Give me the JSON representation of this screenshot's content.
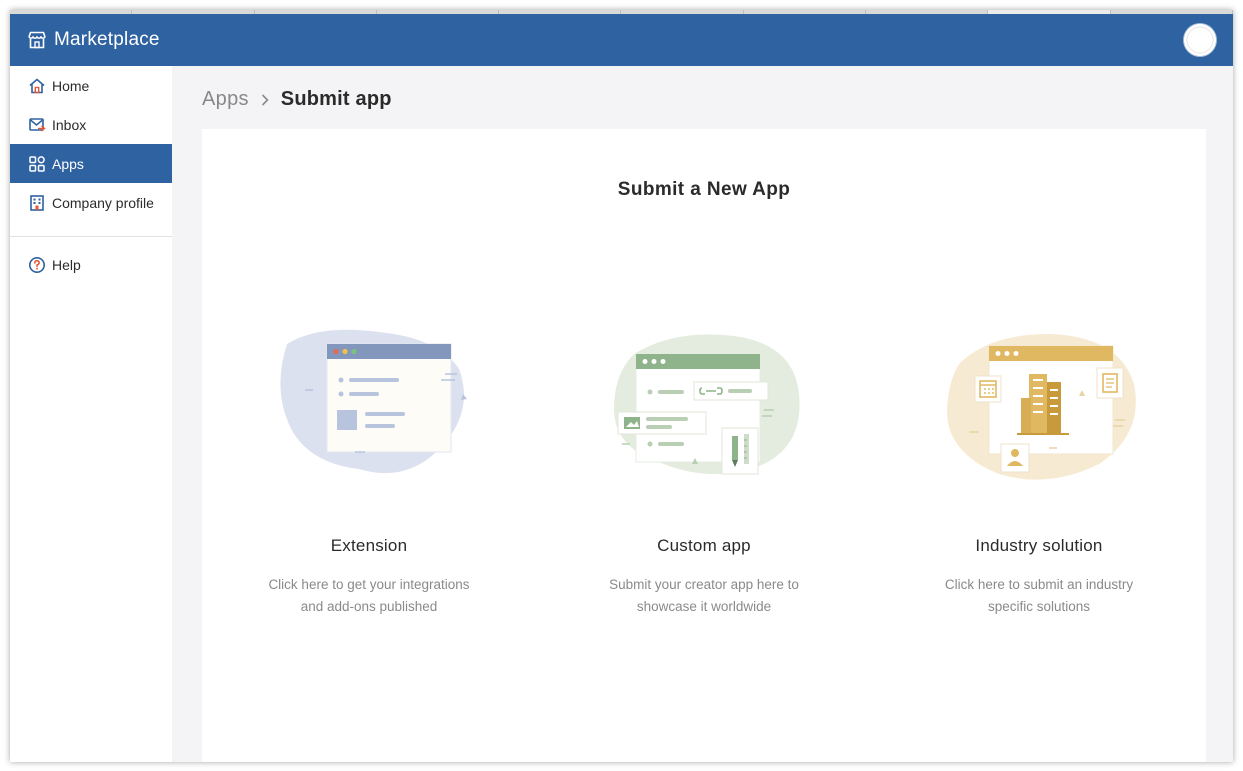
{
  "header": {
    "title": "Marketplace",
    "brand_icon": "storefront-icon",
    "accent_color": "#2e62a0"
  },
  "sidebar": {
    "items": [
      {
        "label": "Home",
        "icon": "home-icon",
        "active": false
      },
      {
        "label": "Inbox",
        "icon": "inbox-icon",
        "active": false
      },
      {
        "label": "Apps",
        "icon": "apps-grid-icon",
        "active": true
      },
      {
        "label": "Company profile",
        "icon": "building-icon",
        "active": false
      }
    ],
    "secondary": [
      {
        "label": "Help",
        "icon": "help-circle-icon"
      }
    ]
  },
  "breadcrumb": {
    "parent": "Apps",
    "current": "Submit app"
  },
  "main": {
    "title": "Submit a New App",
    "cards": [
      {
        "title": "Extension",
        "desc_line1": "Click here to get your integrations",
        "desc_line2": "and add-ons published",
        "color": "#8397bd"
      },
      {
        "title": "Custom app",
        "desc_line1": "Submit your creator app here to",
        "desc_line2": "showcase it worldwide",
        "color": "#8fb38a"
      },
      {
        "title": "Industry solution",
        "desc_line1": "Click here to submit an industry",
        "desc_line2": "specific solutions",
        "color": "#e0b862"
      }
    ]
  }
}
